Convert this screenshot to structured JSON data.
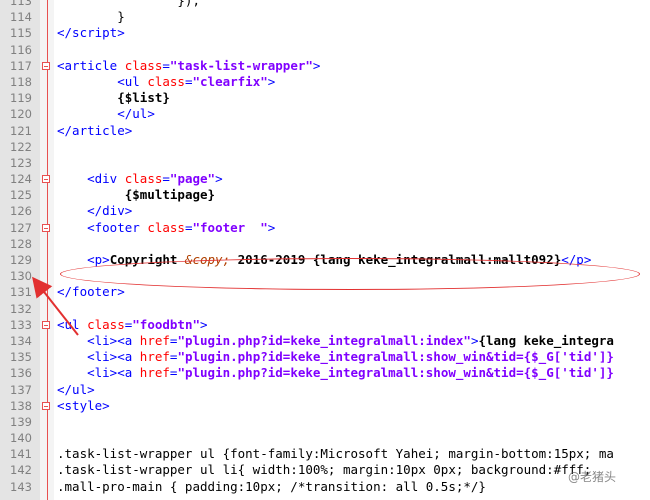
{
  "editor": {
    "lines": [
      {
        "n": "113",
        "html": "<span class='plain'>                });</span>"
      },
      {
        "n": "114",
        "html": "<span class='plain'>        }</span>"
      },
      {
        "n": "115",
        "html": "<span class='tag'>&lt;/script&gt;</span>"
      },
      {
        "n": "116",
        "html": ""
      },
      {
        "n": "117",
        "html": "<span class='tag'>&lt;article </span><span class='attr'>class</span><span class='tag'>=</span><span class='str'>\"task-list-wrapper\"</span><span class='tag'>&gt;</span>",
        "marker": true
      },
      {
        "n": "118",
        "html": "        <span class='tag'>&lt;ul </span><span class='attr'>class</span><span class='tag'>=</span><span class='str'>\"clearfix\"</span><span class='tag'>&gt;</span>"
      },
      {
        "n": "119",
        "html": "        <span class='tpl'>{$list}</span>"
      },
      {
        "n": "120",
        "html": "        <span class='tag'>&lt;/ul&gt;</span>"
      },
      {
        "n": "121",
        "html": "<span class='tag'>&lt;/article&gt;</span>"
      },
      {
        "n": "122",
        "html": ""
      },
      {
        "n": "123",
        "html": ""
      },
      {
        "n": "124",
        "html": "    <span class='tag'>&lt;div </span><span class='attr'>class</span><span class='tag'>=</span><span class='str'>\"page\"</span><span class='tag'>&gt;</span>",
        "marker": true
      },
      {
        "n": "125",
        "html": "         <span class='tpl'>{$multipage}</span>"
      },
      {
        "n": "126",
        "html": "    <span class='tag'>&lt;/div&gt;</span>"
      },
      {
        "n": "127",
        "html": "    <span class='tag'>&lt;footer </span><span class='attr'>class</span><span class='tag'>=</span><span class='str'>\"footer  \"</span><span class='tag'>&gt;</span>",
        "marker": true
      },
      {
        "n": "128",
        "html": ""
      },
      {
        "n": "129",
        "html": "    <span class='tag'>&lt;p&gt;</span><span class='tpl'>Copyright </span><span class='ent'>&amp;copy;</span><span class='tpl'> 2016-2019 {lang keke_integralmall:mallt092}</span><span class='tag'>&lt;/p&gt;</span>"
      },
      {
        "n": "130",
        "html": ""
      },
      {
        "n": "131",
        "html": "<span class='tag'>&lt;/footer&gt;</span>"
      },
      {
        "n": "132",
        "html": ""
      },
      {
        "n": "133",
        "html": "<span class='tag'>&lt;ul </span><span class='attr'>class</span><span class='tag'>=</span><span class='str'>\"foodbtn\"</span><span class='tag'>&gt;</span>",
        "marker": true
      },
      {
        "n": "134",
        "html": "    <span class='tag'>&lt;li&gt;&lt;a </span><span class='attr'>href</span><span class='tag'>=</span><span class='str'>\"plugin.php?id=keke_integralmall:index\"</span><span class='tag'>&gt;</span><span class='tpl'>{lang keke_integra</span>"
      },
      {
        "n": "135",
        "html": "    <span class='tag'>&lt;li&gt;&lt;a </span><span class='attr'>href</span><span class='tag'>=</span><span class='str'>\"plugin.php?id=keke_integralmall:show_win&amp;tid={$_G['tid']}</span>"
      },
      {
        "n": "136",
        "html": "    <span class='tag'>&lt;li&gt;&lt;a </span><span class='attr'>href</span><span class='tag'>=</span><span class='str'>\"plugin.php?id=keke_integralmall:show_win&amp;tid={$_G['tid']}</span>"
      },
      {
        "n": "137",
        "html": "<span class='tag'>&lt;/ul&gt;</span>"
      },
      {
        "n": "138",
        "html": "<span class='tag'>&lt;style&gt;</span>",
        "marker": true
      },
      {
        "n": "139",
        "html": ""
      },
      {
        "n": "140",
        "html": ""
      },
      {
        "n": "141",
        "html": "<span class='css'>.task-list-wrapper ul {font-family:Microsoft Yahei; margin-bottom:15px; ma</span>"
      },
      {
        "n": "142",
        "html": "<span class='css'>.task-list-wrapper ul li{ width:100%; margin:10px 0px; background:#fff; </span>"
      },
      {
        "n": "143",
        "html": "<span class='css'>.mall-pro-main { padding:10px; /*transition: all 0.5s;*/}</span>"
      }
    ],
    "annotation": {
      "arrow_color": "#e23030",
      "ellipse_color": "#e23030"
    },
    "watermark": "@老猪头"
  }
}
